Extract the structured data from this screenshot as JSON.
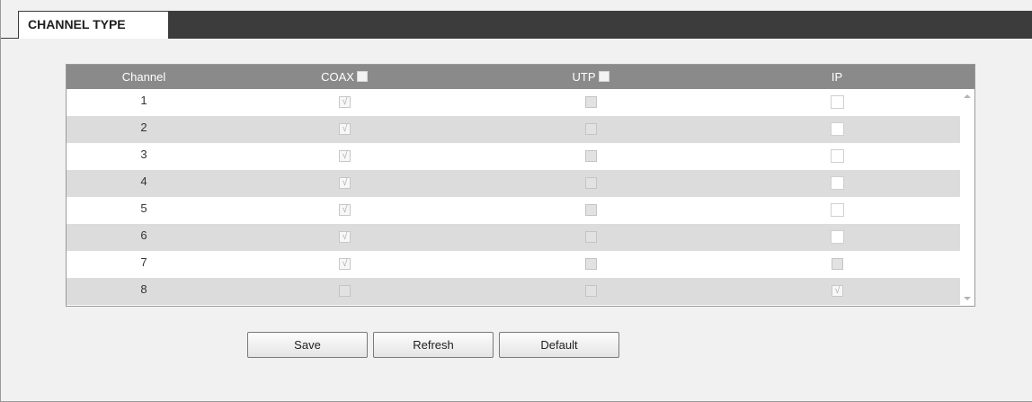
{
  "tab": {
    "label": "CHANNEL TYPE"
  },
  "table": {
    "headers": {
      "channel": "Channel",
      "coax": "COAX",
      "utp": "UTP",
      "ip": "IP"
    },
    "rows": [
      {
        "channel": "1",
        "coax": true,
        "utp": false,
        "ip": false
      },
      {
        "channel": "2",
        "coax": true,
        "utp": false,
        "ip": false
      },
      {
        "channel": "3",
        "coax": true,
        "utp": false,
        "ip": false
      },
      {
        "channel": "4",
        "coax": true,
        "utp": false,
        "ip": false
      },
      {
        "channel": "5",
        "coax": true,
        "utp": false,
        "ip": false
      },
      {
        "channel": "6",
        "coax": true,
        "utp": false,
        "ip": false
      },
      {
        "channel": "7",
        "coax": true,
        "utp": false,
        "ip": false
      },
      {
        "channel": "8",
        "coax": false,
        "utp": false,
        "ip": true
      }
    ]
  },
  "buttons": {
    "save": "Save",
    "refresh": "Refresh",
    "default": "Default"
  },
  "colors": {
    "header_bg": "#8a8a8a",
    "topbar": "#3c3c3c",
    "row_alt": "#dcdcdc"
  }
}
